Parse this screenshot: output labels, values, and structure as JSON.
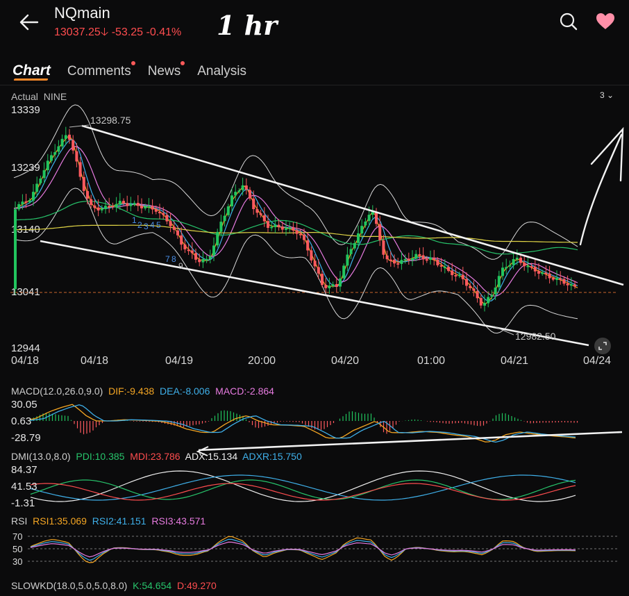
{
  "header": {
    "symbol": "NQmain",
    "price": "13037.25",
    "change": "-53.25",
    "change_pct": "-0.41%",
    "handwritten_note": "1 hr"
  },
  "tabs": [
    {
      "label": "Chart",
      "active": true,
      "dot": false
    },
    {
      "label": "Comments",
      "active": false,
      "dot": true
    },
    {
      "label": "News",
      "active": false,
      "dot": true
    },
    {
      "label": "Analysis",
      "active": false,
      "dot": false
    }
  ],
  "chart": {
    "mode_label": "Actual",
    "indicator_label": "NINE",
    "period_selector": "3",
    "y_ticks": [
      "13339",
      "13239",
      "13140",
      "13041",
      "12944"
    ],
    "high_label": "13298.75",
    "low_label": "12982.50",
    "nine_labels": [
      "1",
      "2",
      "3",
      "4",
      "5",
      "7",
      "8",
      "9"
    ],
    "x_ticks": [
      "04/18",
      "04/18",
      "04/19",
      "20:00",
      "04/20",
      "01:00",
      "04/21",
      "04/24"
    ],
    "current_price": 13037.25,
    "colors": {
      "up": "#22c55e",
      "down": "#ff5a5f",
      "ma1": "#f5a623",
      "ma2": "#3fb0ea",
      "ma3": "#e77be0",
      "ma4": "#27c46b",
      "ma5": "#e2d646",
      "ma6": "#f0f0f0"
    }
  },
  "macd": {
    "title": "MACD(12.0,26.0,9.0)",
    "dif": "DIF:-9.438",
    "dea": "DEA:-8.006",
    "macd": "MACD:-2.864",
    "ticks": [
      "30.05",
      "0.63",
      "-28.79"
    ]
  },
  "dmi": {
    "title": "DMI(13.0,8.0)",
    "pdi": "PDI:10.385",
    "mdi": "MDI:23.786",
    "adx": "ADX:15.134",
    "adxr": "ADXR:15.750",
    "ticks": [
      "84.37",
      "41.53",
      "-1.31"
    ]
  },
  "rsi": {
    "title": "RSI",
    "rsi1": "RSI1:35.069",
    "rsi2": "RSI2:41.151",
    "rsi3": "RSI3:43.571",
    "ticks": [
      "70",
      "50",
      "30"
    ]
  },
  "slowkd": {
    "title": "SLOWKD(18.0,5.0,5.0,8.0)",
    "k": "K:54.654",
    "d": "D:49.270"
  }
}
